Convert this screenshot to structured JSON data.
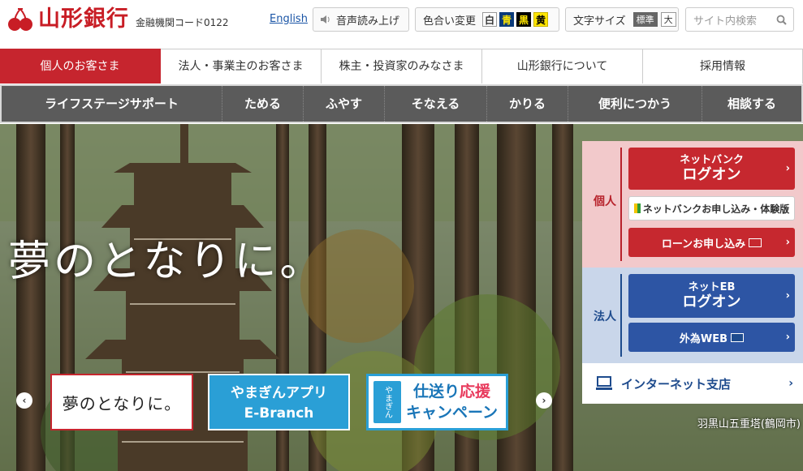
{
  "header": {
    "logo": {
      "name": "山形銀行",
      "code": "金融機関コード0122"
    },
    "english": "English",
    "speech": "音声読み上げ",
    "color_change": {
      "label": "色合い変更",
      "options": [
        "白",
        "青",
        "黒",
        "黄"
      ]
    },
    "font_size": {
      "label": "文字サイズ",
      "options": [
        "標準",
        "大"
      ],
      "selected": "標準"
    },
    "search": {
      "placeholder": "サイト内検索"
    }
  },
  "nav_primary": [
    {
      "label": "個人のお客さま",
      "active": true
    },
    {
      "label": "法人・事業主のお客さま",
      "active": false
    },
    {
      "label": "株主・投資家のみなさま",
      "active": false
    },
    {
      "label": "山形銀行について",
      "active": false
    },
    {
      "label": "採用情報",
      "active": false
    }
  ],
  "nav_secondary": [
    "ライフステージサポート",
    "ためる",
    "ふやす",
    "そなえる",
    "かりる",
    "便利につかう",
    "相談する"
  ],
  "hero": {
    "slogan": "夢のとなりに。",
    "caption": "羽黒山五重塔(鶴岡市)",
    "banners": {
      "b1": "夢のとなりに。",
      "b2": {
        "line1": "やまぎんアプリ",
        "line2": "E-Branch"
      },
      "b3": {
        "logo": "やまぎん",
        "line1a": "仕送り",
        "line1b": "応援",
        "line2": "キャンペーン"
      }
    }
  },
  "login_panel": {
    "personal": {
      "label": "個人",
      "netbank": {
        "line1": "ネットバンク",
        "line2": "ログオン"
      },
      "apply": "ネットバンクお申し込み・体験版",
      "loan": "ローンお申し込み"
    },
    "corporate": {
      "label": "法人",
      "neteb": {
        "line1": "ネットEB",
        "line2": "ログオン"
      },
      "forex": "外為WEB"
    },
    "internet_branch": "インターネット支店"
  },
  "colors": {
    "brand_red": "#c6252e",
    "nav_gray": "#5b5b5b",
    "blue": "#2d55a4",
    "app_blue": "#2a9fd6"
  }
}
